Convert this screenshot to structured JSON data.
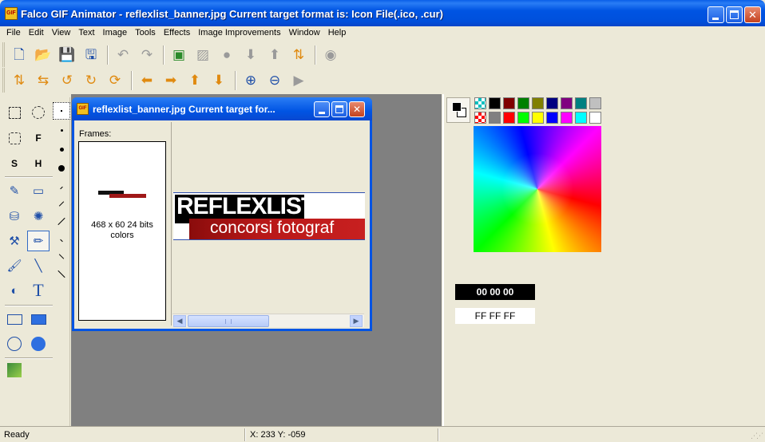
{
  "window": {
    "title": "Falco GIF Animator - reflexlist_banner.jpg  Current target format is: Icon File(.ico, .cur)",
    "icon_name": "app-gif-icon",
    "minimize_label": "_",
    "maximize_label": "□",
    "close_label": "✕",
    "accent_color": "#0054E3"
  },
  "menu": [
    "File",
    "Edit",
    "View",
    "Text",
    "Image",
    "Tools",
    "Effects",
    "Image Improvements",
    "Window",
    "Help"
  ],
  "toolbar1": [
    {
      "icon": "new-file-icon",
      "glyph": "🗋",
      "color": "c-blue"
    },
    {
      "icon": "open-folder-icon",
      "glyph": "📂",
      "color": "c-orange"
    },
    {
      "icon": "save-icon",
      "glyph": "💾",
      "color": "c-blue"
    },
    {
      "icon": "save-as-icon",
      "glyph": "🖫",
      "color": "c-blue"
    },
    {
      "icon": "undo-icon",
      "glyph": "↶",
      "color": "c-gray"
    },
    {
      "icon": "redo-icon",
      "glyph": "↷",
      "color": "c-gray"
    },
    {
      "icon": "add-frame-icon",
      "glyph": "▣",
      "color": "c-green"
    },
    {
      "icon": "delete-frame-icon",
      "glyph": "▨",
      "color": "c-gray"
    },
    {
      "icon": "frame-props-icon",
      "glyph": "●",
      "color": "c-gray"
    },
    {
      "icon": "move-down-icon",
      "glyph": "⬇",
      "color": "c-gray"
    },
    {
      "icon": "move-up-icon",
      "glyph": "⬆",
      "color": "c-gray"
    },
    {
      "icon": "swap-frames-icon",
      "glyph": "⇅",
      "color": "c-orange"
    },
    {
      "icon": "play-settings-icon",
      "glyph": "◉",
      "color": "c-gray"
    }
  ],
  "toolbar2": [
    {
      "icon": "flip-vertical-icon",
      "glyph": "⇅",
      "color": "c-orange"
    },
    {
      "icon": "flip-horizontal-icon",
      "glyph": "⇆",
      "color": "c-orange"
    },
    {
      "icon": "rotate-left-90-icon",
      "glyph": "↺",
      "color": "c-orange"
    },
    {
      "icon": "rotate-right-90-icon",
      "glyph": "↻",
      "color": "c-orange"
    },
    {
      "icon": "rotate-custom-icon",
      "glyph": "⟳",
      "color": "c-orange"
    },
    {
      "icon": "arrow-left-icon",
      "glyph": "⬅",
      "color": "c-orange"
    },
    {
      "icon": "arrow-right-icon",
      "glyph": "➡",
      "color": "c-orange"
    },
    {
      "icon": "arrow-up-icon",
      "glyph": "⬆",
      "color": "c-orange"
    },
    {
      "icon": "arrow-down-icon",
      "glyph": "⬇",
      "color": "c-orange"
    },
    {
      "icon": "zoom-in-icon",
      "glyph": "⊕",
      "color": "c-blue"
    },
    {
      "icon": "zoom-out-icon",
      "glyph": "⊖",
      "color": "c-blue"
    },
    {
      "icon": "play-icon",
      "glyph": "▶",
      "color": "c-gray"
    }
  ],
  "child_window": {
    "title": "reflexlist_banner.jpg  Current target for...",
    "frames_label": "Frames:",
    "frame_info_line1": "468 x 60 24 bits",
    "frame_info_line2": "colors",
    "banner_main": "REFLEXLIST.com",
    "banner_sub": "concorsi fotograf",
    "scroll_left": "◀",
    "scroll_right": "▶"
  },
  "palette": {
    "row1": [
      "#00C0C0",
      "#000000",
      "#800000",
      "#008000",
      "#808000",
      "#000080",
      "#800080",
      "#008080",
      "#C0C0C0"
    ],
    "row2": [
      "#FF0000",
      "#808080",
      "#FF0000",
      "#00FF00",
      "#FFFF00",
      "#0000FF",
      "#FF00FF",
      "#00FFFF",
      "#FFFFFF"
    ],
    "foreground_hex": "00 00 00",
    "background_hex": "FF FF FF"
  },
  "status": {
    "left": "Ready",
    "coords": "X: 233 Y: -059"
  }
}
